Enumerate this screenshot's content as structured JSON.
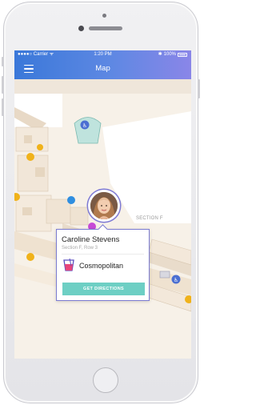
{
  "status_bar": {
    "carrier": "●●●●○ Carrier ᯤ",
    "time": "1:20 PM",
    "battery": "100%"
  },
  "navbar": {
    "title": "Map",
    "menu_icon": "hamburger-menu-icon"
  },
  "map": {
    "section_label": "SECTION F",
    "icons": [
      "accessible-icon",
      "restroom-icon",
      "info-icon",
      "food-icon",
      "escalator-icon"
    ]
  },
  "user_card": {
    "name": "Caroline Stevens",
    "seat": "Section F, Row 3",
    "drink_icon": "cocktail-icon",
    "drink": "Cosmopolitan",
    "directions_button": "GET DIRECTIONS"
  },
  "colors": {
    "nav_gradient_start": "#3a78d9",
    "nav_gradient_end": "#8a86e8",
    "card_border": "#7b7bd0",
    "button": "#6dcfc4",
    "map_floor": "#f7f1e8"
  }
}
